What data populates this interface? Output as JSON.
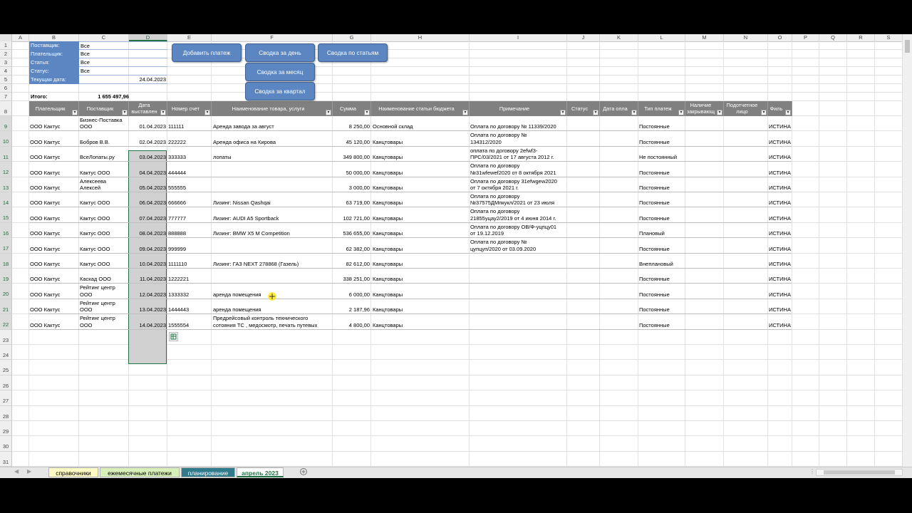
{
  "columns": [
    "A",
    "B",
    "C",
    "D",
    "E",
    "F",
    "G",
    "H",
    "I",
    "J",
    "K",
    "L",
    "M",
    "N",
    "O",
    "P",
    "Q",
    "R",
    "S"
  ],
  "row_numbers": [
    "1",
    "2",
    "3",
    "4",
    "5",
    "6",
    "7",
    "8",
    "9",
    "10",
    "11",
    "12",
    "13",
    "14",
    "15",
    "16",
    "17",
    "18",
    "19",
    "20",
    "21",
    "22",
    "23",
    "24",
    "25",
    "26",
    "27",
    "28",
    "29",
    "30",
    "31"
  ],
  "filters": [
    {
      "label": "Поставщик:",
      "value": "Все"
    },
    {
      "label": "Плательщик:",
      "value": "Все"
    },
    {
      "label": "Статья:",
      "value": "Все"
    },
    {
      "label": "Статус:",
      "value": "Все"
    },
    {
      "label": "Текущая дата:",
      "value": "24.04.2023"
    }
  ],
  "total": {
    "label": "Итого:",
    "value": "1 655 497,96"
  },
  "buttons": {
    "add_payment": "Добавить платеж",
    "day": "Сводка за день",
    "articles": "Сводка по статьям",
    "month": "Сводка за месяц",
    "quarter": "Сводка за квартал"
  },
  "headers": [
    [
      "Плательщик"
    ],
    [
      "Поставщик"
    ],
    [
      "Дата",
      "выставлен"
    ],
    [
      "Номер счет"
    ],
    [
      "Наименование товара, услуги"
    ],
    [
      "Сумма"
    ],
    [
      "Наименование статьи бюджета"
    ],
    [
      "Примечание"
    ],
    [
      "Статус"
    ],
    [
      "Дата опла"
    ],
    [
      "Тип платеж"
    ],
    [
      "Наличие",
      "закрывающ"
    ],
    [
      "Подотчетное",
      "лицо"
    ],
    [
      "Филь"
    ]
  ],
  "rows": [
    {
      "payer": "ООО Кактус",
      "supplier": [
        "Бизнес-Поставка",
        "ООО"
      ],
      "date": "01.04.2023",
      "invoice": "111111",
      "goods": [
        "",
        "Аренда завода за август"
      ],
      "sum": "8 250,00",
      "article": "Основной склад",
      "note": [
        "",
        "Оплата по договору № 11339/2020"
      ],
      "type": "Постоянные",
      "filter": "ИСТИНА"
    },
    {
      "payer": "ООО Кактус",
      "supplier": [
        "",
        "Бобров В.В."
      ],
      "date": "02.04.2023",
      "invoice": "222222",
      "goods": [
        "",
        "Аренда офиса на Кирова"
      ],
      "sum": "45 120,00",
      "article": "Канцтовары",
      "note": [
        "Оплата по договору №",
        "134312/2020"
      ],
      "type": "Постоянные",
      "filter": "ИСТИНА"
    },
    {
      "payer": "ООО Кактус",
      "supplier": [
        "",
        "ВсеЛопаты.ру"
      ],
      "date": "03.04.2023",
      "invoice": "333333",
      "goods": [
        "",
        "лопаты"
      ],
      "sum": "349 800,00",
      "article": "Канцтовары",
      "note": [
        "оплата по договору 2efwf3-",
        "ПРС/03/2021 от 17 августа 2012 г."
      ],
      "type": "Не постоянный",
      "filter": "ИСТИНА"
    },
    {
      "payer": "ООО Кактус",
      "supplier": [
        "",
        "Кактус ООО"
      ],
      "date": "04.04.2023",
      "invoice": "444444",
      "goods": [
        "",
        ""
      ],
      "sum": "50 000,00",
      "article": "Канцтовары",
      "note": [
        "Оплата по договору",
        "№31wfewef2020 от 8 октября 2021"
      ],
      "type": "Постоянные",
      "filter": "ИСТИНА"
    },
    {
      "payer": "ООО Кактус",
      "supplier": [
        "Алексеева",
        "Алексей"
      ],
      "date": "05.04.2023",
      "invoice": "555555",
      "goods": [
        "",
        ""
      ],
      "sum": "3 000,00",
      "article": "Канцтовары",
      "note": [
        "Оплата по договору 31efwgew2020",
        "от 7 октября 2021 г."
      ],
      "type": "Постоянные",
      "filter": "ИСТИНА"
    },
    {
      "payer": "ООО Кактус",
      "supplier": [
        "",
        "Кактус ООО"
      ],
      "date": "06.04.2023",
      "invoice": "666666",
      "goods": [
        "",
        "Лизинг: Nissan Qashqai"
      ],
      "sum": "63 719,00",
      "article": "Канцтовары",
      "note": [
        "Оплата по договору",
        "№37575ДМпкукл/2021 от 23 июля"
      ],
      "type": "Постоянные",
      "filter": "ИСТИНА"
    },
    {
      "payer": "ООО Кактус",
      "supplier": [
        "",
        "Кактус ООО"
      ],
      "date": "07.04.2023",
      "invoice": "777777",
      "goods": [
        "",
        "Лизинг: AUDI A5 Sportback"
      ],
      "sum": "102 721,00",
      "article": "Канцтовары",
      "note": [
        "Оплата по договору",
        "21855уцау2/2019 от 4 июня 2014 г."
      ],
      "type": "Постоянные",
      "filter": "ИСТИНА"
    },
    {
      "payer": "ООО Кактус",
      "supplier": [
        "",
        "Кактус ООО"
      ],
      "date": "08.04.2023",
      "invoice": "888888",
      "goods": [
        "",
        "Лизинг: BMW X5 M Competition"
      ],
      "sum": "536 655,00",
      "article": "Канцтовары",
      "note": [
        "Оплата по договору ОВ/Ф-уцпцу01",
        "от 19.12.2019"
      ],
      "type": "Плановый",
      "filter": "ИСТИНА"
    },
    {
      "payer": "ООО Кактус",
      "supplier": [
        "",
        "Кактус ООО"
      ],
      "date": "09.04.2023",
      "invoice": "999999",
      "goods": [
        "",
        ""
      ],
      "sum": "62 382,00",
      "article": "Канцтовары",
      "note": [
        "Оплата по договору №",
        "цупцуп/2020 от 03.09.2020"
      ],
      "type": "Постоянные",
      "filter": "ИСТИНА"
    },
    {
      "payer": "ООО Кактус",
      "supplier": [
        "",
        "Кактус ООО"
      ],
      "date": "10.04.2023",
      "invoice": "1111110",
      "goods": [
        "",
        "Лизинг: ГАЗ NEXT 278868 (Газель)"
      ],
      "sum": "82 612,00",
      "article": "Канцтовары",
      "note": [
        "",
        ""
      ],
      "type": "Внеплановый",
      "filter": "ИСТИНА"
    },
    {
      "payer": "ООО Кактус",
      "supplier": [
        "",
        "Каскад ООО"
      ],
      "date": "11.04.2023",
      "invoice": "1222221",
      "goods": [
        "",
        ""
      ],
      "sum": "338 251,00",
      "article": "Канцтовары",
      "note": [
        "",
        ""
      ],
      "type": "Постоянные",
      "filter": "ИСТИНА"
    },
    {
      "payer": "ООО Кактус",
      "supplier": [
        "Рейтинг центр",
        "ООО"
      ],
      "date": "12.04.2023",
      "invoice": "1333332",
      "goods": [
        "",
        "аренда помещения"
      ],
      "sum": "6 000,00",
      "article": "Канцтовары",
      "note": [
        "",
        ""
      ],
      "type": "Постоянные",
      "filter": "ИСТИНА"
    },
    {
      "payer": "ООО Кактус",
      "supplier": [
        "Рейтинг центр",
        "ООО"
      ],
      "date": "13.04.2023",
      "invoice": "1444443",
      "goods": [
        "",
        "аренда помещения"
      ],
      "sum": "2 187,96",
      "article": "Канцтовары",
      "note": [
        "",
        ""
      ],
      "type": "Постоянные",
      "filter": "ИСТИНА"
    },
    {
      "payer": "ООО Кактус",
      "supplier": [
        "Рейтинг центр",
        "ООО"
      ],
      "date": "14.04.2023",
      "invoice": "1555554",
      "goods": [
        "Предрейсовый контроль технического",
        "сотояния ТС , медосмотр, печать путевых"
      ],
      "sum": "4 800,00",
      "article": "Канцтовары",
      "note": [
        "",
        ""
      ],
      "type": "Постоянные",
      "filter": "ИСТИНА"
    }
  ],
  "tabs": [
    "справочники",
    "ежемесячные платежи",
    "планирование",
    "апрель 2023"
  ],
  "colors": {
    "button_blue": "#5b86c1",
    "header_gray": "#808080",
    "selection": "#d1d1d1",
    "excel_green": "#217346"
  },
  "icons": {
    "quick_analysis": "quick-analysis-icon",
    "add_sheet": "plus-circle-icon"
  }
}
